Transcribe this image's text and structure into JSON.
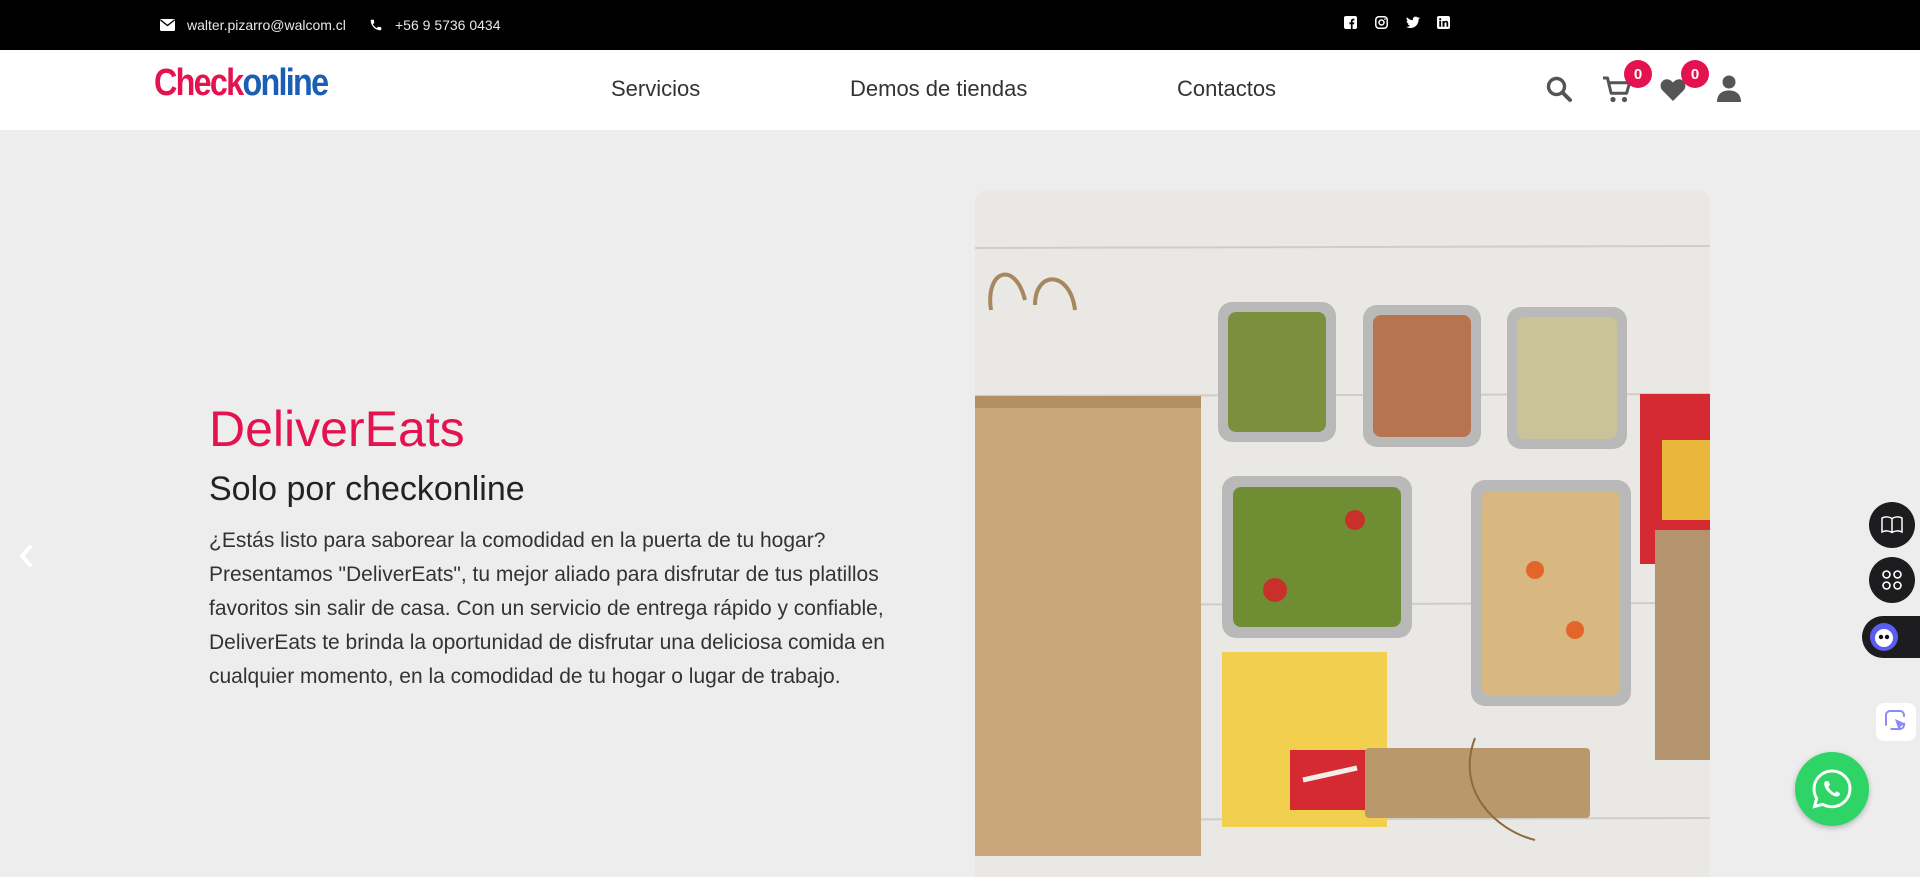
{
  "topbar": {
    "email": "walter.pizarro@walcom.cl",
    "phone": "+56 9 5736 0434",
    "socials": [
      "facebook-icon",
      "instagram-icon",
      "twitter-icon",
      "linkedin-icon"
    ]
  },
  "header": {
    "logo": {
      "part1": "Check",
      "part2": "online"
    },
    "nav": [
      "Servicios",
      "Demos de tiendas",
      "Contactos"
    ],
    "cart_count": "0",
    "wishlist_count": "0"
  },
  "hero": {
    "title": "DeliverEats",
    "subtitle": "Solo por checkonline",
    "description": "¿Estás listo para saborear la comodidad en la puerta de tu hogar? Presentamos \"DeliverEats\", tu mejor aliado para disfrutar de tus platillos favoritos sin salir de casa. Con un servicio de entrega rápido y confiable, DeliverEats te brinda la oportunidad de disfrutar una deliciosa comida en cualquier momento, en la comodidad de tu hogar o lugar de trabajo."
  },
  "colors": {
    "accent": "#e4134f",
    "logo_blue": "#1a5fb4",
    "topbar_bg": "#000000",
    "hero_bg": "#eeeded",
    "whatsapp": "#2fd466"
  }
}
